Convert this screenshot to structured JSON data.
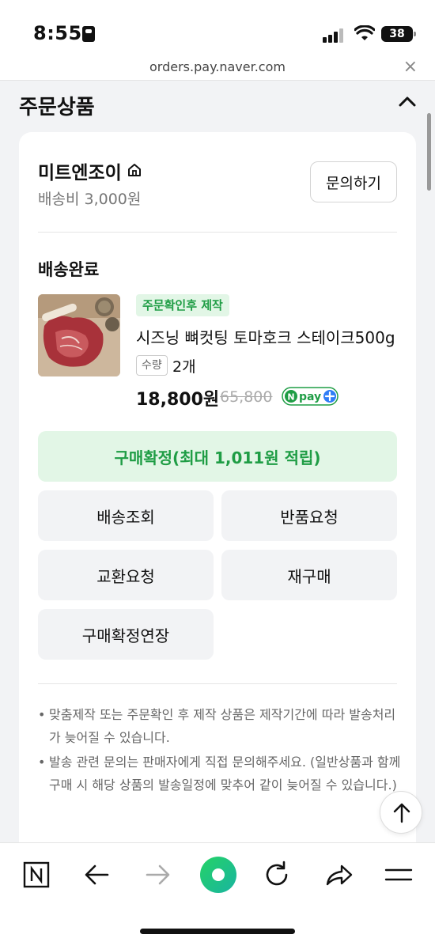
{
  "status_bar": {
    "time": "8:55",
    "battery": "38"
  },
  "browser": {
    "url": "orders.pay.naver.com",
    "close_label": "×"
  },
  "section": {
    "title": "주문상품"
  },
  "seller": {
    "name": "미트엔조이",
    "shipping_fee": "배송비 3,000원",
    "inquiry_label": "문의하기"
  },
  "order": {
    "status": "배송완료",
    "badge": "주문확인후 제작",
    "product_name": "시즈닝 뼈컷팅 토마호크 스테이크500g",
    "qty_label": "수량",
    "qty_value": "2개",
    "price": "18,800원",
    "original_price": "65,800",
    "pay_logo_text": "pay"
  },
  "actions": {
    "confirm": "구매확정(최대 1,011원 적립)",
    "track": "배송조회",
    "return": "반품요청",
    "exchange": "교환요청",
    "rebuy": "재구매",
    "extend": "구매확정연장"
  },
  "notes": [
    "맞춤제작 또는 주문확인 후 제작 상품은 제작기간에 따라 발송처리가 늦어질 수 있습니다.",
    "발송 관련 문의는 판매자에게 직접 문의해주세요. (일반상품과 함께 구매 시 해당 상품의 발송일정에 맞추어 같이 늦어질 수 있습니다.)"
  ],
  "toolbar": {
    "icons": [
      "naver-n-icon",
      "back-icon",
      "forward-icon",
      "green-dot-icon",
      "reload-icon",
      "share-icon",
      "menu-icon"
    ]
  },
  "colors": {
    "accent_green": "#1f9d45",
    "green_bg": "#e2f6e6",
    "npay_blue": "#2f7df6"
  }
}
